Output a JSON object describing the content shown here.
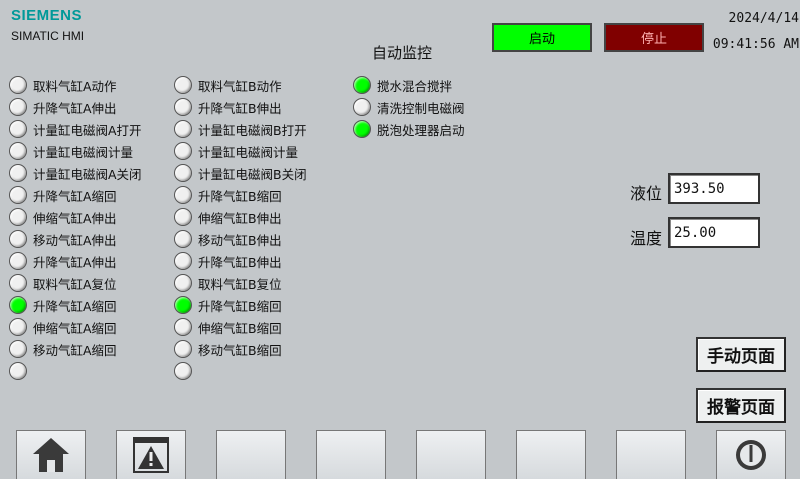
{
  "header": {
    "brand": "SIEMENS",
    "product": "SIMATIC HMI",
    "date": "2024/4/14",
    "time": "09:41:56 AM",
    "title": "自动监控",
    "run_label": "启动",
    "stop_label": "停止"
  },
  "colors": {
    "lamp_on": "#00ff00",
    "lamp_off": "#f0f0f0",
    "run": "#00ff00",
    "stop": "#800000",
    "brand": "#009999"
  },
  "columns": [
    [
      {
        "label": "取料气缸A动作",
        "on": false
      },
      {
        "label": "升降气缸A伸出",
        "on": false
      },
      {
        "label": "计量缸电磁阀A打开",
        "on": false
      },
      {
        "label": "计量缸电磁阀计量",
        "on": false
      },
      {
        "label": "计量缸电磁阀A关闭",
        "on": false
      },
      {
        "label": "升降气缸A缩回",
        "on": false
      },
      {
        "label": "伸缩气缸A伸出",
        "on": false
      },
      {
        "label": "移动气缸A伸出",
        "on": false
      },
      {
        "label": "升降气缸A伸出",
        "on": false
      },
      {
        "label": "取料气缸A复位",
        "on": false
      },
      {
        "label": "升降气缸A缩回",
        "on": true
      },
      {
        "label": "伸缩气缸A缩回",
        "on": false
      },
      {
        "label": "移动气缸A缩回",
        "on": false
      },
      {
        "label": "",
        "on": false
      }
    ],
    [
      {
        "label": "取料气缸B动作",
        "on": false
      },
      {
        "label": "升降气缸B伸出",
        "on": false
      },
      {
        "label": "计量缸电磁阀B打开",
        "on": false
      },
      {
        "label": "计量缸电磁阀计量",
        "on": false
      },
      {
        "label": "计量缸电磁阀B关闭",
        "on": false
      },
      {
        "label": "升降气缸B缩回",
        "on": false
      },
      {
        "label": "伸缩气缸B伸出",
        "on": false
      },
      {
        "label": "移动气缸B伸出",
        "on": false
      },
      {
        "label": "升降气缸B伸出",
        "on": false
      },
      {
        "label": "取料气缸B复位",
        "on": false
      },
      {
        "label": "升降气缸B缩回",
        "on": true
      },
      {
        "label": "伸缩气缸B缩回",
        "on": false
      },
      {
        "label": "移动气缸B缩回",
        "on": false
      },
      {
        "label": "",
        "on": false
      }
    ],
    [
      {
        "label": "搅水混合搅拌",
        "on": true
      },
      {
        "label": "清洗控制电磁阀",
        "on": false
      },
      {
        "label": "脱泡处理器启动",
        "on": true
      }
    ]
  ],
  "readouts": {
    "level_label": "液位",
    "level_value": "393.50",
    "temp_label": "温度",
    "temp_value": "25.00"
  },
  "nav": {
    "manual": "手动页面",
    "alarm": "报警页面"
  },
  "fkeys": [
    "home-icon",
    "alarm-warning-icon",
    "",
    "",
    "",
    "",
    "",
    "power-icon"
  ]
}
